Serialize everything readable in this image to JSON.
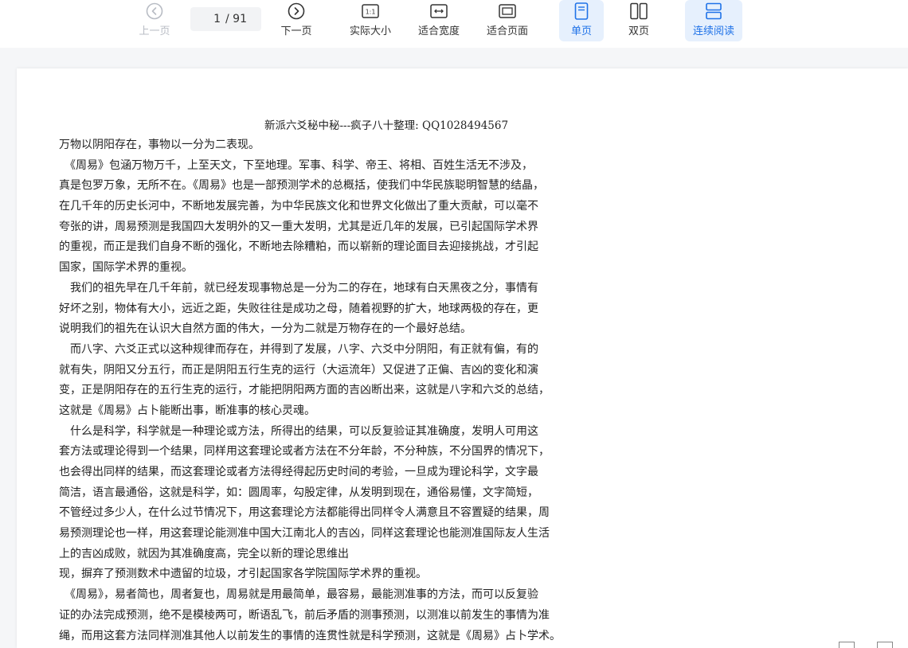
{
  "toolbar": {
    "prev_label": "上一页",
    "page_current": "1",
    "page_total": "/ 91",
    "next_label": "下一页",
    "actual_size_label": "实际大小",
    "actual_size_icon_text": "1:1",
    "fit_width_label": "适合宽度",
    "fit_page_label": "适合页面",
    "single_page_label": "单页",
    "double_page_label": "双页",
    "continuous_label": "连续阅读",
    "accent_color": "#1f72e8"
  },
  "document": {
    "title": "新派六爻秘中秘---疯子八十整理: QQ1028494567",
    "lines": [
      "万物以阴阳存在，事物以一分为二表现。",
      "　《周易》包涵万物万千，上至天文，下至地理。军事、科学、帝王、将相、百姓生活无不涉及，",
      "真是包罗万象，无所不在。《周易》也是一部预测学术的总概括，使我们中华民族聪明智慧的结晶，",
      "在几千年的历史长河中，不断地发展完善，为中华民族文化和世界文化做出了重大贡献，可以毫不",
      "夸张的讲，周易预测是我国四大发明外的又一重大发明，尤其是近几年的发展，已引起国际学术界",
      "的重视，而正是我们自身不断的强化，不断地去除糟粕，而以崭新的理论面目去迎接挑战，才引起",
      "国家，国际学术界的重视。",
      "　我们的祖先早在几千年前，就已经发现事物总是一分为二的存在，地球有白天黑夜之分，事情有",
      "好坏之别，物体有大小，远近之距，失败往往是成功之母，随着视野的扩大，地球两极的存在，更",
      "说明我们的祖先在认识大自然方面的伟大，一分为二就是万物存在的一个最好总结。",
      "　而八字、六爻正式以这种规律而存在，并得到了发展，八字、六爻中分阴阳，有正就有偏，有的",
      "就有失，阴阳又分五行，而正是阴阳五行生克的运行（大运流年）又促进了正偏、吉凶的变化和演",
      "变，正是阴阳存在的五行生克的运行，才能把阴阳两方面的吉凶断出来，这就是八字和六爻的总结，",
      "这就是《周易》占卜能断出事，断准事的核心灵魂。",
      "　什么是科学，科学就是一种理论或方法，所得出的结果，可以反复验证其准确度，发明人可用这",
      "套方法或理论得到一个结果，同样用这套理论或者方法在不分年龄，不分种族，不分国界的情况下，",
      "也会得出同样的结果，而这套理论或者方法得经得起历史时间的考验，一旦成为理论科学，文字最",
      "简洁，语言最通俗，这就是科学，如：圆周率，勾股定律，从发明到现在，通俗易懂，文字简短，",
      "不管经过多少人，在什么过节情况下，用这套理论方法都能得出同样令人满意且不容置疑的结果，周",
      "易预测理论也一样，用这套理论能测准中国大江南北人的吉凶，同样这套理论也能测准国际友人生活",
      "上的吉凶成败，就因为其准确度高，完全以新的理论思维出",
      "现，摒弃了预测数术中遗留的垃圾，才引起国家各学院国际学术界的重视。",
      "　《周易》，易者简也，周者复也，周易就是用最简单，最容易，最能测准事的方法，而可以反复验",
      "证的办法完成预测，绝不是模棱两可，断语乱飞，前后矛盾的测事预测，以测准以前发生的事情为准",
      "绳，而用这套方法同样测准其他人以前发生的事情的连贯性就是科学预测，这就是《周易》占卜学术。"
    ]
  }
}
